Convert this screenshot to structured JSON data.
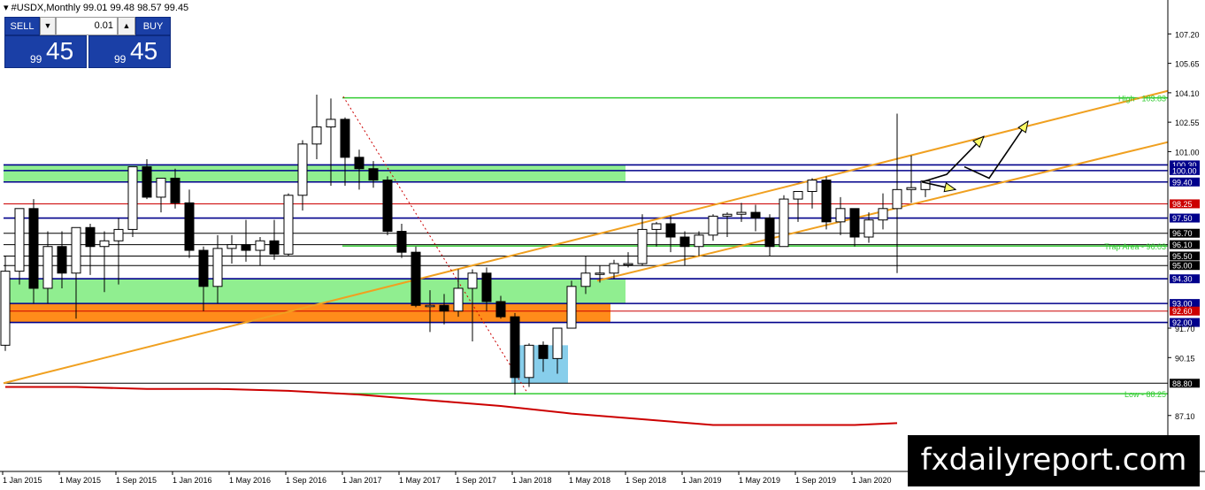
{
  "header": {
    "symbol_line": "#USDX,Monthly  99.01 99.48 98.57 99.45"
  },
  "trade_panel": {
    "sell_label": "SELL",
    "buy_label": "BUY",
    "lot_value": "0.01",
    "sell_price_small": "99",
    "sell_price_big": "45",
    "buy_price_small": "99",
    "buy_price_big": "45"
  },
  "brand": "fxdailyreport.com",
  "colors": {
    "channel": "#f0a020",
    "level_blue": "#00008b",
    "level_red": "#cc0000",
    "level_green": "#33cc33",
    "zone_green": "#90ee90",
    "zone_orange": "#ff8c1a",
    "zone_blue": "#87ceeb",
    "ma": "#cc0000",
    "candle_bear": "#000000",
    "candle_bull": "#ffffff"
  },
  "chart_data": {
    "type": "candlestick",
    "timeframe": "Monthly",
    "symbol": "#USDX",
    "ylim": [
      84.2,
      108.8
    ],
    "x_tick_labels": [
      "1 Jan 2015",
      "1 May 2015",
      "1 Sep 2015",
      "1 Jan 2016",
      "1 May 2016",
      "1 Sep 2016",
      "1 Jan 2017",
      "1 May 2017",
      "1 Sep 2017",
      "1 Jan 2018",
      "1 May 2018",
      "1 Sep 2018",
      "1 Jan 2019",
      "1 May 2019",
      "1 Sep 2019",
      "1 Jan 2020"
    ],
    "y_tick_labels": [
      "107.20",
      "105.65",
      "104.10",
      "102.55",
      "101.00",
      "91.70",
      "90.15",
      "87.10"
    ],
    "candles": [
      [
        90.8,
        95.5,
        90.5,
        94.7
      ],
      [
        94.7,
        98.0,
        94.0,
        98.0
      ],
      [
        98.0,
        98.5,
        93.0,
        93.8
      ],
      [
        93.8,
        96.8,
        93.0,
        96.0
      ],
      [
        96.0,
        96.8,
        93.8,
        94.6
      ],
      [
        94.6,
        97.0,
        92.2,
        97.0
      ],
      [
        97.0,
        97.2,
        94.5,
        96.0
      ],
      [
        96.0,
        96.8,
        93.6,
        96.3
      ],
      [
        96.3,
        97.5,
        94.0,
        96.9
      ],
      [
        96.9,
        100.2,
        96.5,
        100.2
      ],
      [
        100.2,
        100.6,
        98.5,
        98.6
      ],
      [
        98.6,
        99.6,
        97.8,
        99.6
      ],
      [
        99.6,
        100.1,
        98.0,
        98.3
      ],
      [
        98.3,
        99.0,
        95.4,
        95.8
      ],
      [
        95.8,
        96.0,
        92.6,
        93.9
      ],
      [
        93.9,
        96.6,
        93.0,
        95.9
      ],
      [
        95.9,
        96.6,
        95.1,
        96.1
      ],
      [
        96.1,
        97.4,
        95.2,
        95.8
      ],
      [
        95.8,
        96.5,
        95.0,
        96.3
      ],
      [
        96.3,
        97.4,
        95.3,
        95.6
      ],
      [
        95.6,
        98.8,
        95.5,
        98.7
      ],
      [
        98.7,
        101.6,
        97.9,
        101.4
      ],
      [
        101.4,
        104.0,
        100.6,
        102.3
      ],
      [
        102.3,
        103.8,
        99.2,
        102.7
      ],
      [
        102.7,
        102.8,
        99.2,
        100.7
      ],
      [
        100.7,
        101.1,
        99.0,
        100.1
      ],
      [
        100.1,
        100.5,
        99.1,
        99.5
      ],
      [
        99.5,
        99.7,
        96.6,
        96.8
      ],
      [
        96.8,
        97.2,
        95.4,
        95.7
      ],
      [
        95.7,
        96.0,
        92.8,
        92.9
      ],
      [
        92.9,
        93.7,
        91.5,
        92.9
      ],
      [
        92.9,
        93.5,
        91.9,
        92.6
      ],
      [
        92.6,
        94.8,
        92.3,
        93.8
      ],
      [
        93.8,
        94.8,
        91.0,
        94.6
      ],
      [
        94.6,
        94.9,
        92.6,
        93.1
      ],
      [
        93.1,
        93.4,
        92.2,
        92.3
      ],
      [
        92.3,
        92.5,
        88.2,
        89.1
      ],
      [
        89.1,
        90.9,
        88.6,
        90.8
      ],
      [
        90.8,
        91.0,
        89.4,
        90.1
      ],
      [
        90.1,
        91.6,
        89.3,
        91.7
      ],
      [
        91.7,
        94.2,
        91.7,
        93.9
      ],
      [
        93.9,
        95.5,
        93.5,
        94.6
      ],
      [
        94.6,
        95.0,
        94.1,
        94.6
      ],
      [
        94.6,
        95.3,
        94.3,
        95.1
      ],
      [
        95.1,
        95.7,
        94.9,
        95.1
      ],
      [
        95.1,
        97.7,
        95.0,
        96.9
      ],
      [
        96.9,
        97.3,
        96.0,
        97.2
      ],
      [
        97.2,
        97.6,
        95.7,
        96.5
      ],
      [
        96.5,
        96.8,
        95.0,
        96.0
      ],
      [
        96.0,
        96.8,
        95.5,
        96.6
      ],
      [
        96.6,
        97.7,
        96.3,
        97.6
      ],
      [
        97.6,
        97.8,
        96.5,
        97.7
      ],
      [
        97.7,
        98.3,
        97.3,
        97.8
      ],
      [
        97.8,
        98.2,
        96.8,
        97.5
      ],
      [
        97.5,
        97.7,
        95.5,
        96.0
      ],
      [
        96.0,
        98.7,
        96.0,
        98.5
      ],
      [
        98.5,
        98.8,
        97.3,
        98.9
      ],
      [
        98.9,
        99.6,
        98.0,
        99.5
      ],
      [
        99.5,
        99.7,
        96.9,
        97.3
      ],
      [
        97.3,
        98.6,
        96.6,
        98.0
      ],
      [
        98.0,
        98.0,
        96.0,
        96.5
      ],
      [
        96.5,
        97.8,
        96.2,
        97.4
      ],
      [
        97.4,
        98.8,
        96.9,
        98.0
      ],
      [
        98.0,
        103.0,
        94.6,
        99.0
      ],
      [
        99.0,
        100.8,
        98.3,
        99.1
      ],
      [
        99.0,
        99.5,
        98.6,
        99.45
      ]
    ],
    "levels": [
      {
        "price": 100.3,
        "label": "100.30",
        "color": "#00008b"
      },
      {
        "price": 100.0,
        "label": "100.00",
        "color": "#00008b"
      },
      {
        "price": 99.4,
        "label": "99.40",
        "color": "#00008b"
      },
      {
        "price": 98.25,
        "label": "98.25",
        "color": "#cc0000"
      },
      {
        "price": 97.5,
        "label": "97.50",
        "color": "#00008b"
      },
      {
        "price": 96.7,
        "label": "96.70",
        "color": "#000000"
      },
      {
        "price": 96.1,
        "label": "96.10",
        "color": "#000000"
      },
      {
        "price": 95.5,
        "label": "95.50",
        "color": "#000000"
      },
      {
        "price": 95.0,
        "label": "95.00",
        "color": "#000000"
      },
      {
        "price": 94.3,
        "label": "94.30",
        "color": "#00008b"
      },
      {
        "price": 93.0,
        "label": "93.00",
        "color": "#00008b"
      },
      {
        "price": 92.6,
        "label": "92.60",
        "color": "#cc0000"
      },
      {
        "price": 92.0,
        "label": "92.00",
        "color": "#00008b"
      },
      {
        "price": 88.8,
        "label": "88.80",
        "color": "#000000"
      }
    ],
    "annotations": [
      {
        "text": "High - 103.83",
        "price": 103.83
      },
      {
        "text": "Trap Area - 96.03",
        "price": 96.03
      },
      {
        "text": "Low - 88.25",
        "price": 88.25
      }
    ],
    "moving_average": [
      [
        0,
        88.6
      ],
      [
        5,
        88.6
      ],
      [
        10,
        88.5
      ],
      [
        15,
        88.5
      ],
      [
        20,
        88.4
      ],
      [
        25,
        88.2
      ],
      [
        30,
        87.9
      ],
      [
        35,
        87.6
      ],
      [
        40,
        87.2
      ],
      [
        45,
        86.9
      ],
      [
        50,
        86.6
      ],
      [
        55,
        86.6
      ],
      [
        60,
        86.6
      ],
      [
        63,
        86.7
      ]
    ]
  }
}
